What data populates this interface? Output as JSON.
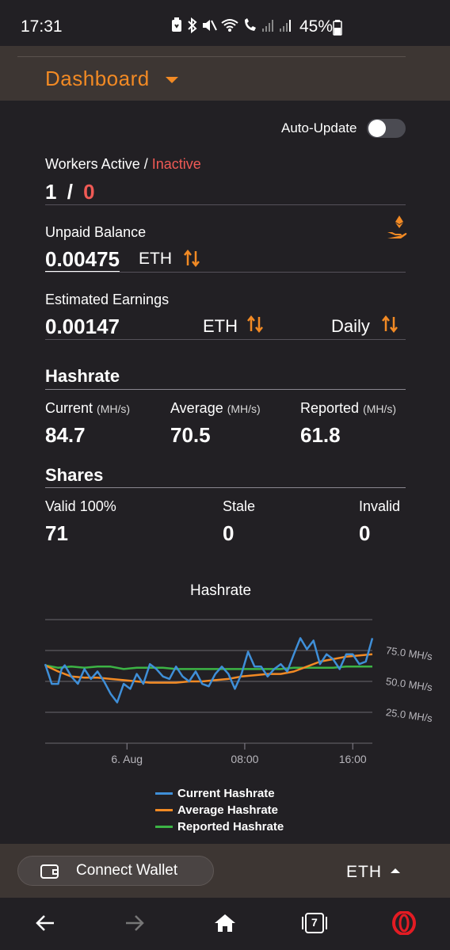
{
  "status_bar": {
    "time": "17:31",
    "battery": "45%"
  },
  "header": {
    "title": "Dashboard"
  },
  "auto_update": {
    "label": "Auto-Update",
    "enabled": false
  },
  "workers": {
    "label_prefix": "Workers Active / ",
    "label_inactive": "Inactive",
    "active": "1",
    "separator": "/",
    "inactive": "0"
  },
  "unpaid_balance": {
    "label": "Unpaid Balance",
    "value": "0.00475",
    "unit": "ETH"
  },
  "estimated_earnings": {
    "label": "Estimated Earnings",
    "value": "0.00147",
    "unit": "ETH",
    "period": "Daily"
  },
  "hashrate": {
    "title": "Hashrate",
    "unit": "(MH/s)",
    "current_label": "Current",
    "current_value": "84.7",
    "average_label": "Average",
    "average_value": "70.5",
    "reported_label": "Reported",
    "reported_value": "61.8"
  },
  "shares": {
    "title": "Shares",
    "valid_label": "Valid 100%",
    "valid_value": "71",
    "stale_label": "Stale",
    "stale_value": "0",
    "invalid_label": "Invalid",
    "invalid_value": "0"
  },
  "chart_data": {
    "type": "line",
    "title": "Hashrate",
    "y_tick_labels": [
      "75.0 MH/s",
      "50.0 MH/s",
      "25.0 MH/s"
    ],
    "x_tick_labels": [
      "6. Aug",
      "08:00",
      "16:00"
    ],
    "ylim": [
      0,
      100
    ],
    "xlim": [
      0,
      100
    ],
    "x_ticks": [
      25,
      61,
      94
    ],
    "grid": true,
    "legend_position": "bottom",
    "series": [
      {
        "name": "Current Hashrate",
        "color": "#3f8fd8",
        "x": [
          0,
          2,
          4,
          5,
          6,
          8,
          10,
          12,
          14,
          16,
          18,
          20,
          22,
          24,
          26,
          28,
          30,
          32,
          34,
          36,
          38,
          40,
          42,
          44,
          46,
          48,
          50,
          52,
          54,
          56,
          58,
          60,
          62,
          64,
          66,
          68,
          70,
          72,
          74,
          76,
          78,
          80,
          82,
          84,
          86,
          88,
          90,
          92,
          94,
          96,
          98,
          100
        ],
        "y": [
          64,
          48,
          48,
          60,
          63,
          54,
          48,
          60,
          52,
          58,
          50,
          40,
          33,
          48,
          44,
          56,
          48,
          64,
          60,
          54,
          52,
          62,
          54,
          50,
          58,
          48,
          46,
          56,
          62,
          56,
          44,
          56,
          74,
          62,
          62,
          54,
          60,
          64,
          58,
          72,
          85,
          76,
          83,
          64,
          72,
          68,
          60,
          72,
          72,
          64,
          66,
          85
        ]
      },
      {
        "name": "Average Hashrate",
        "color": "#f28a24",
        "x": [
          0,
          4,
          8,
          12,
          16,
          20,
          24,
          28,
          32,
          36,
          40,
          44,
          48,
          52,
          56,
          60,
          64,
          68,
          72,
          76,
          80,
          84,
          88,
          92,
          96,
          100
        ],
        "y": [
          63,
          58,
          54,
          53,
          53,
          52,
          51,
          50,
          49,
          49,
          49,
          50,
          50,
          51,
          52,
          54,
          55,
          56,
          56,
          58,
          62,
          66,
          68,
          70,
          71,
          72
        ]
      },
      {
        "name": "Reported Hashrate",
        "color": "#3cb445",
        "x": [
          0,
          4,
          8,
          12,
          16,
          20,
          24,
          28,
          32,
          36,
          40,
          44,
          48,
          52,
          56,
          60,
          64,
          68,
          72,
          76,
          80,
          84,
          88,
          92,
          96,
          100
        ],
        "y": [
          63,
          61,
          62,
          61,
          62,
          62,
          60,
          61,
          61,
          61,
          60,
          60,
          60,
          60,
          60,
          60,
          60,
          60,
          60,
          61,
          61,
          61,
          61,
          62,
          62,
          62
        ]
      }
    ]
  },
  "bottom_bar": {
    "wallet_label": "Connect Wallet",
    "coin": "ETH"
  },
  "nav": {
    "tabs_count": "7"
  }
}
